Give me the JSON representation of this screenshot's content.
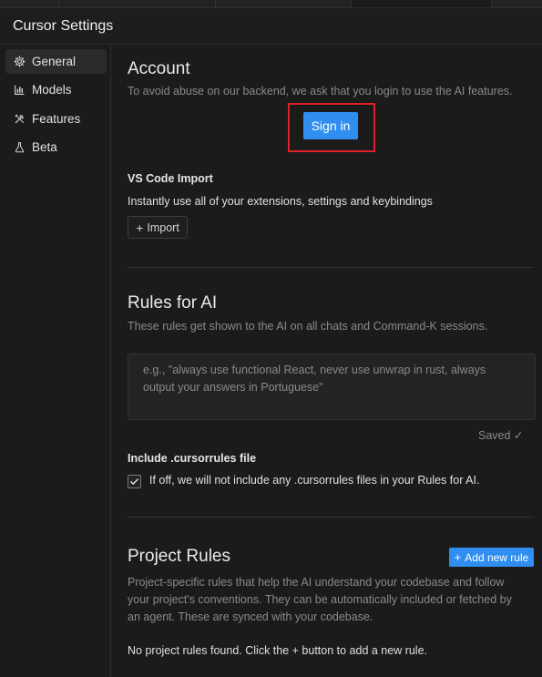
{
  "window": {
    "title": "Cursor Settings"
  },
  "sidebar": {
    "items": [
      {
        "label": "General",
        "icon": "gear-icon",
        "active": true
      },
      {
        "label": "Models",
        "icon": "bar-chart-icon",
        "active": false
      },
      {
        "label": "Features",
        "icon": "tools-icon",
        "active": false
      },
      {
        "label": "Beta",
        "icon": "flask-icon",
        "active": false
      }
    ]
  },
  "account": {
    "title": "Account",
    "description": "To avoid abuse on our backend, we ask that you login to use the AI features.",
    "signin_label": "Sign in",
    "highlight_color": "#e21e2a",
    "button_color": "#2f8ef0"
  },
  "vscode_import": {
    "title": "VS Code Import",
    "description": "Instantly use all of your extensions, settings and keybindings",
    "import_label": "Import"
  },
  "rules_for_ai": {
    "title": "Rules for AI",
    "description": "These rules get shown to the AI on all chats and Command-K sessions.",
    "placeholder": "e.g., \"always use functional React, never use unwrap in rust, always output your answers in Portuguese\"",
    "status": "Saved ✓"
  },
  "cursorrules": {
    "title": "Include .cursorrules file",
    "checkbox_label": "If off, we will not include any .cursorrules files in your Rules for AI.",
    "checked": true
  },
  "project_rules": {
    "title": "Project Rules",
    "add_label": "Add new rule",
    "description_line1": "Project-specific rules that help the AI understand your codebase and follow",
    "description_line2": "your project's conventions. They can be automatically included or fetched by",
    "description_line3": "an agent. These are synced with your codebase.",
    "empty_message": "No project rules found. Click the + button to add a new rule."
  }
}
